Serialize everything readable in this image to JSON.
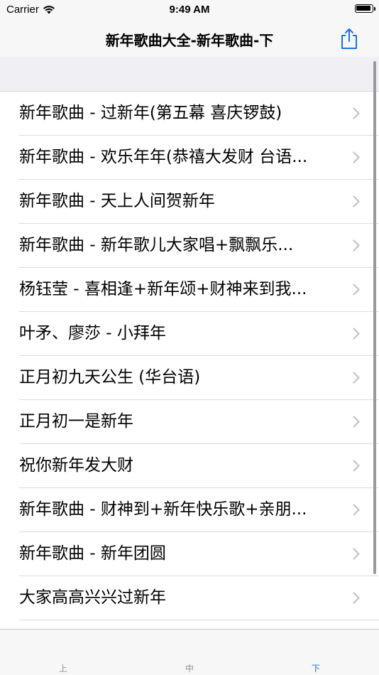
{
  "status_bar": {
    "carrier": "Carrier",
    "time": "9:49 AM"
  },
  "nav": {
    "title": "新年歌曲大全-新年歌曲-下",
    "share_icon": "share-icon"
  },
  "list": {
    "items": [
      {
        "label": "新年歌曲 - 过新年(第五幕 喜庆锣鼓)"
      },
      {
        "label": "新年歌曲 - 欢乐年年(恭禧大发财 台语..."
      },
      {
        "label": "新年歌曲 - 天上人间贺新年"
      },
      {
        "label": "新年歌曲 - 新年歌儿大家唱+飘飘乐..."
      },
      {
        "label": "杨钰莹 - 喜相逢+新年颂+财神来到我..."
      },
      {
        "label": "叶矛、廖莎 - 小拜年"
      },
      {
        "label": "正月初九天公生 (华台语)"
      },
      {
        "label": "正月初一是新年"
      },
      {
        "label": "祝你新年发大财"
      },
      {
        "label": "新年歌曲 - 财神到+新年快乐歌+亲朋..."
      },
      {
        "label": "新年歌曲 - 新年团圆"
      },
      {
        "label": "大家高高兴兴过新年"
      }
    ]
  },
  "tabs": [
    {
      "label": "上"
    },
    {
      "label": "中"
    },
    {
      "label": "下",
      "selected": true
    }
  ],
  "colors": {
    "accent": "#1a73e8",
    "tab_inactive": "#8e8e93",
    "background": "#efeff4"
  }
}
